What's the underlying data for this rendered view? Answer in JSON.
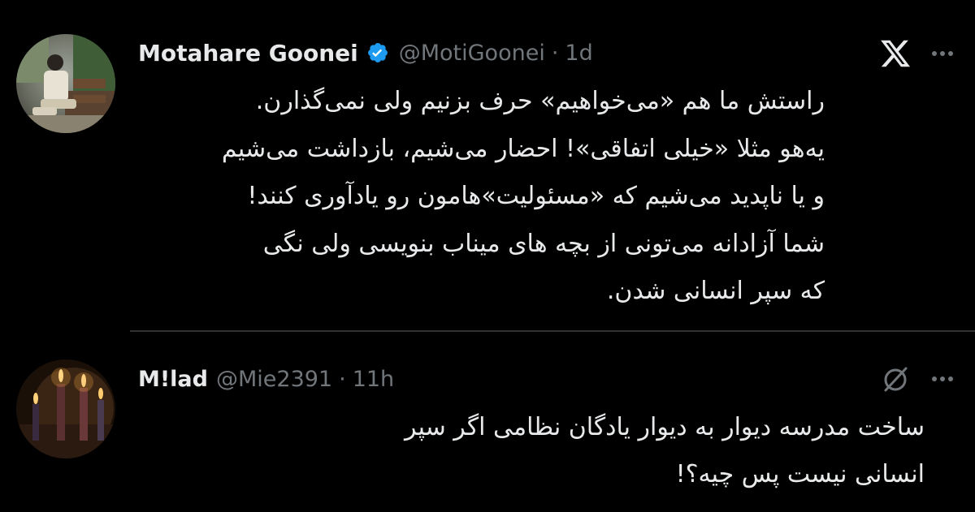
{
  "tweet": {
    "display_name": "Motahare Goonei",
    "verified": true,
    "handle": "@MotiGoonei",
    "separator": "·",
    "time": "1d",
    "avatar_icon": "profile-photo-woman-sitting-on-bench",
    "brand_icon": "x-logo-icon",
    "text_lines": [
      "راستش ما هم «می‌خواهیم» حرف بزنیم ولی نمی‌گذارن.",
      "یه‌هو مثلا «خیلی اتفاقی»! احضار می‌شیم، بازداشت می‌شیم",
      "و یا ناپدید می‌شیم که «مسئولیت»هامون رو یادآوری کنند!",
      "شما آزادانه می‌تونی از بچه های میناب بنویسی ولی نگی",
      "که سپر انسانی شدن."
    ]
  },
  "reply": {
    "display_name": "M!lad",
    "handle": "@Mie2391",
    "separator": "·",
    "time": "11h",
    "avatar_icon": "profile-photo-candles",
    "grok_icon": "grok-icon",
    "text_lines": [
      "ساخت مدرسه دیوار به دیوار یادگان نظامی اگر سپر",
      "انسانی نیست پس چیه؟!"
    ]
  },
  "colors": {
    "background": "#000000",
    "text_primary": "#e7e9ea",
    "text_secondary": "#71767b",
    "verified_blue": "#1d9bf0",
    "divider": "#2f3336"
  }
}
